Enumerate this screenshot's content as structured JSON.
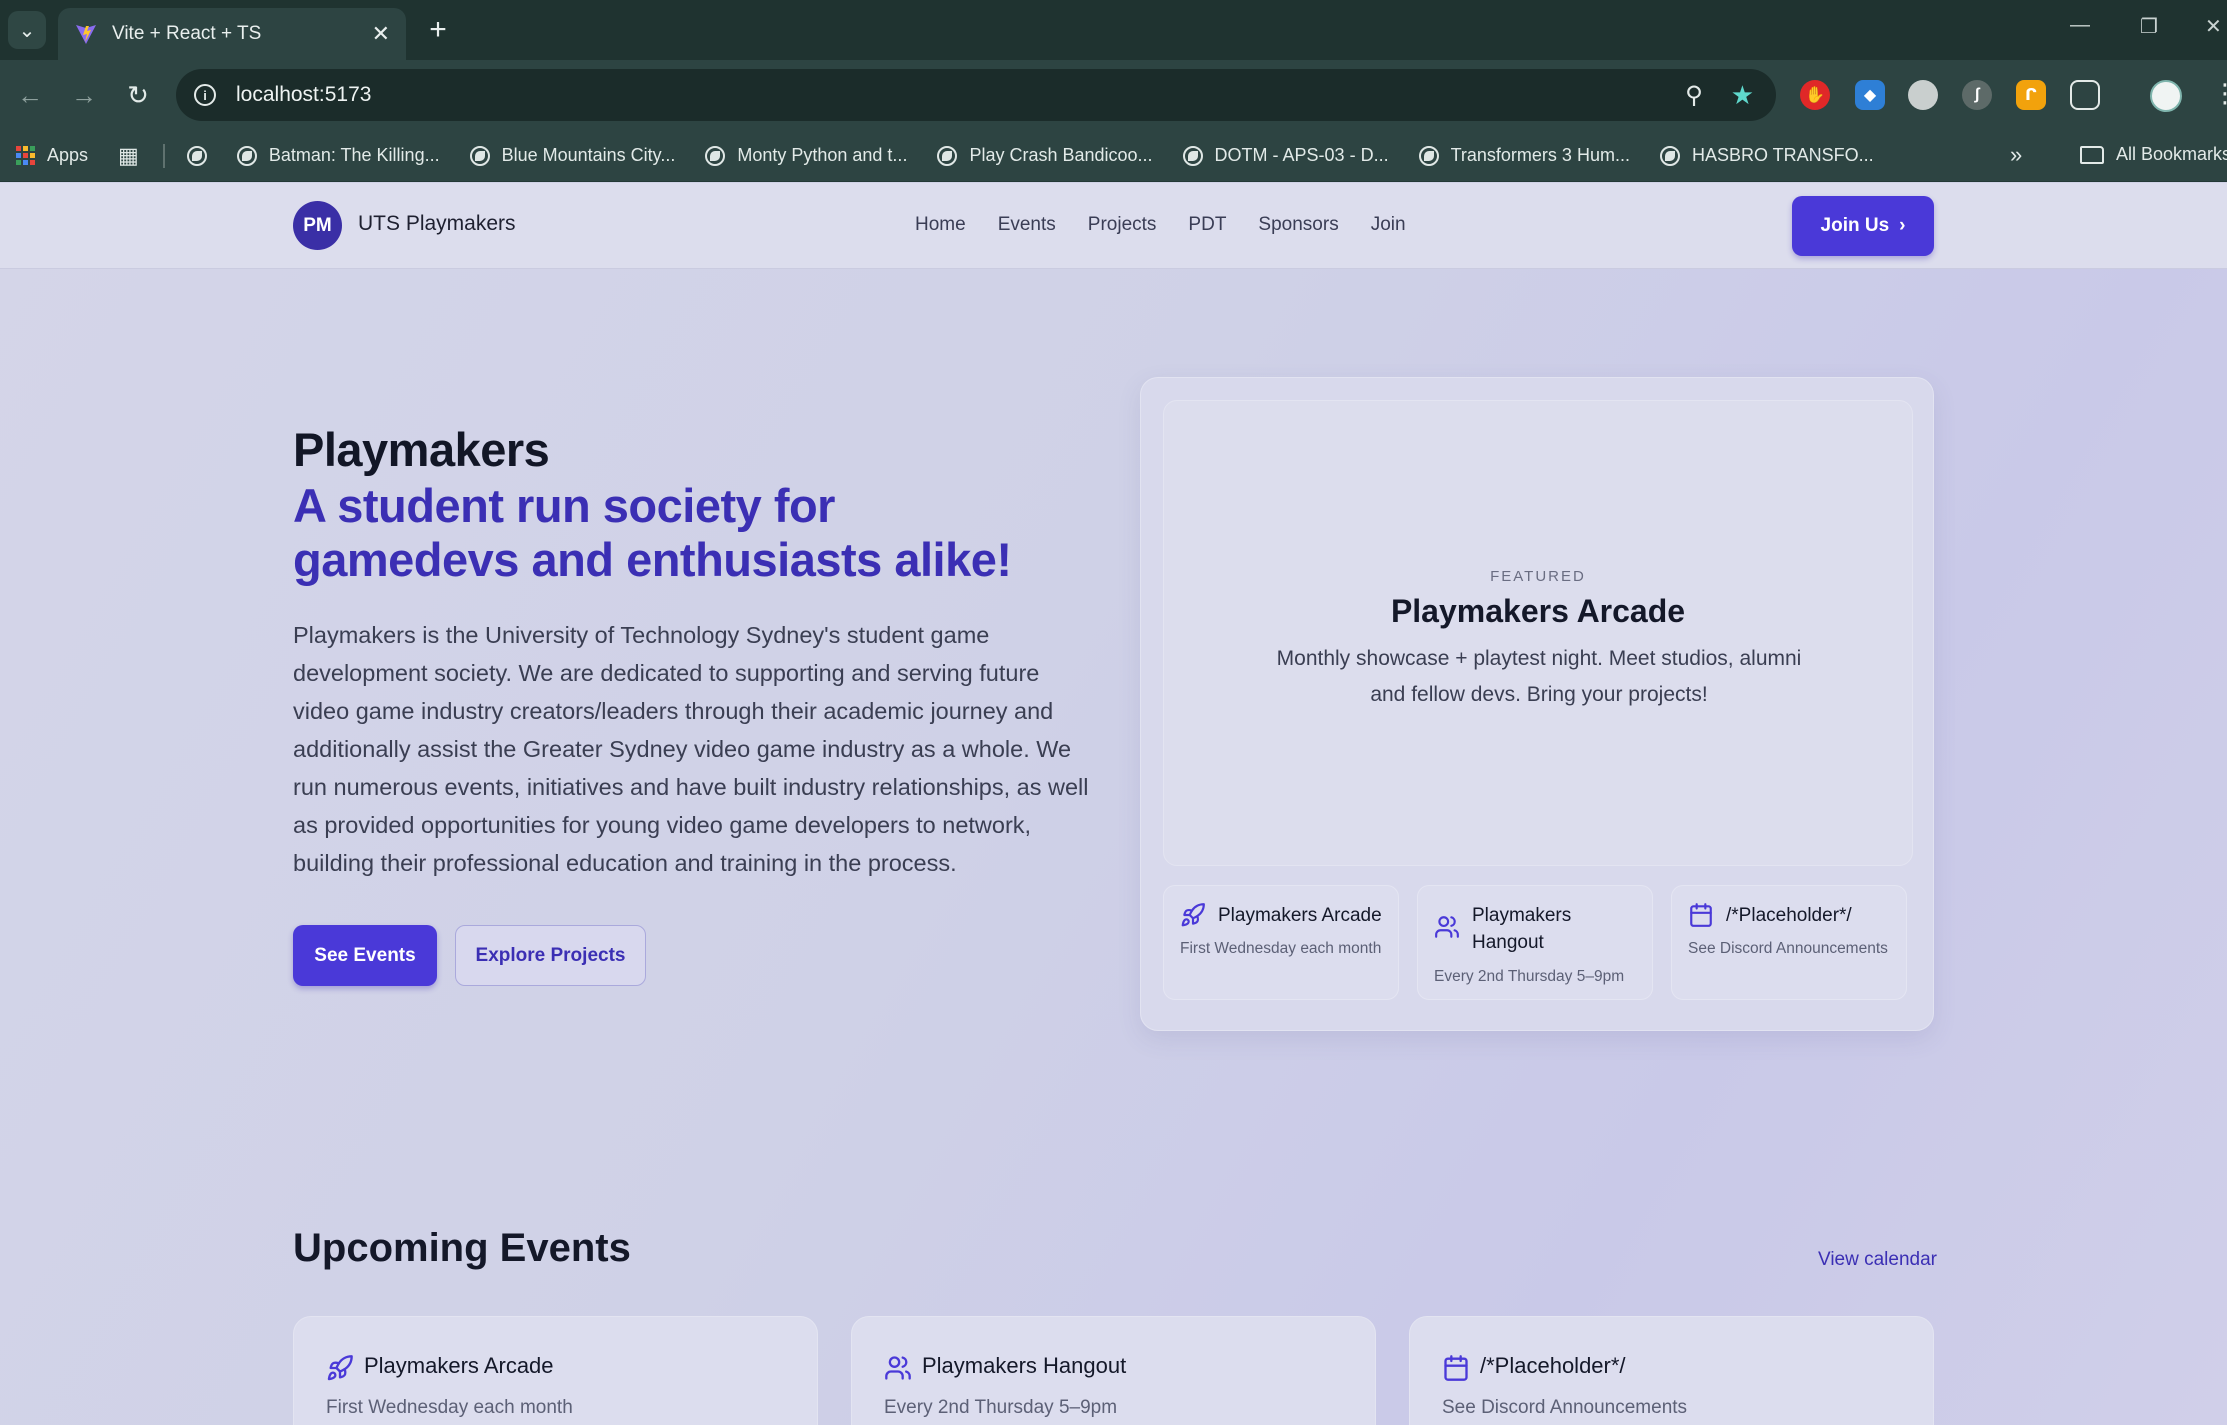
{
  "browser": {
    "tab_title": "Vite + React + TS",
    "url": "localhost:5173",
    "bookmarks": [
      "Apps",
      "Batman: The Killing...",
      "Blue Mountains City...",
      "Monty Python and t...",
      "Play Crash Bandicoo...",
      "DOTM - APS-03 - D...",
      "Transformers 3 Hum...",
      "HASBRO TRANSFO..."
    ],
    "all_bookmarks": "All Bookmarks"
  },
  "site": {
    "logo": "PM",
    "brand": "UTS Playmakers",
    "nav": [
      "Home",
      "Events",
      "Projects",
      "PDT",
      "Sponsors",
      "Join"
    ],
    "join_button": "Join Us"
  },
  "hero": {
    "title": "Playmakers",
    "subtitle": "A student run society for gamedevs and enthusiasts alike!",
    "description": "Playmakers is the University of Technology Sydney's student game development society. We are dedicated to supporting and serving future video game industry creators/leaders through their academic journey and additionally assist the Greater Sydney video game industry as a whole. We run numerous events, initiatives and have built industry relationships, as well as provided opportunities for young video game developers to network, building their professional education and training in the process.",
    "primary_button": "See Events",
    "secondary_button": "Explore Projects"
  },
  "featured": {
    "label": "FEATURED",
    "title": "Playmakers Arcade",
    "description": "Monthly showcase + playtest night. Meet studios, alumni and fellow devs. Bring your projects!",
    "cards": [
      {
        "icon": "rocket-icon",
        "title": "Playmakers Arcade",
        "subtitle": "First Wednesday each month"
      },
      {
        "icon": "users-icon",
        "title": "Playmakers Hangout",
        "subtitle": "Every 2nd Thursday 5–9pm"
      },
      {
        "icon": "calendar-icon",
        "title": "/*Placeholder*/",
        "subtitle": "See Discord Announcements"
      }
    ]
  },
  "events": {
    "title": "Upcoming Events",
    "view_calendar": "View calendar",
    "cards": [
      {
        "icon": "rocket-icon",
        "title": "Playmakers Arcade",
        "subtitle": "First Wednesday each month"
      },
      {
        "icon": "users-icon",
        "title": "Playmakers Hangout",
        "subtitle": "Every 2nd Thursday 5–9pm"
      },
      {
        "icon": "calendar-icon",
        "title": "/*Placeholder*/",
        "subtitle": "See Discord Announcements"
      }
    ]
  },
  "colors": {
    "accent": "#4a39d8",
    "accent_text": "#3b2fb4",
    "chrome_bg": "#2d4442"
  }
}
